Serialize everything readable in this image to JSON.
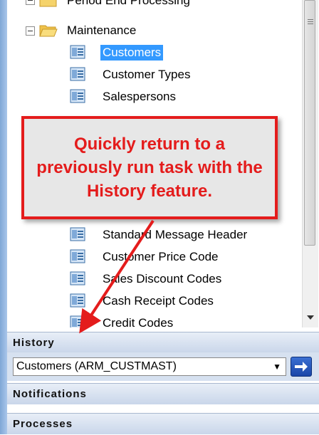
{
  "tree": {
    "items": [
      {
        "label": "Period End Processing",
        "icon": "folder-icon"
      },
      {
        "label": "Maintenance",
        "icon": "folder-open-icon"
      },
      {
        "label": "Customers",
        "icon": "task-icon",
        "selected": true
      },
      {
        "label": "Customer Types",
        "icon": "task-icon"
      },
      {
        "label": "Salespersons",
        "icon": "task-icon"
      },
      {
        "label": "Standard Message Header",
        "icon": "task-icon"
      },
      {
        "label": "Customer Price Code",
        "icon": "task-icon"
      },
      {
        "label": "Sales Discount Codes",
        "icon": "task-icon"
      },
      {
        "label": "Cash Receipt Codes",
        "icon": "task-icon"
      },
      {
        "label": "Credit Codes",
        "icon": "task-icon"
      }
    ]
  },
  "history": {
    "header": "History",
    "selected_task": "Customers (ARM_CUSTMAST)",
    "go_icon": "arrow-right-icon"
  },
  "notifications": {
    "header": "Notifications"
  },
  "processes": {
    "header": "Processes"
  },
  "callout": {
    "text": "Quickly return to a previously run task with the History feature.",
    "color": "#e41c1c"
  },
  "colors": {
    "selection": "#3399ff",
    "panel_header": "#c9d6ea",
    "go_button": "#1a46a8"
  }
}
